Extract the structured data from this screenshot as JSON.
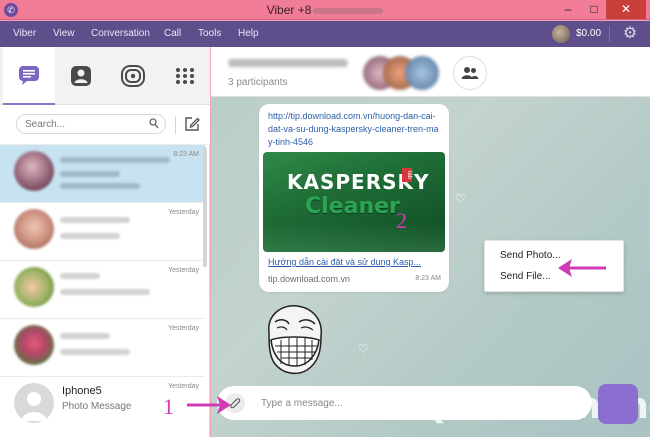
{
  "window": {
    "title": "Viber +8",
    "controls": [
      "minimize",
      "maximize",
      "close"
    ]
  },
  "menu": {
    "items": [
      "Viber",
      "View",
      "Conversation",
      "Call",
      "Tools",
      "Help"
    ],
    "balance": "$0.00"
  },
  "sidebar": {
    "tabs": [
      {
        "name": "chats-icon",
        "active": true
      },
      {
        "name": "contacts-icon",
        "active": false
      },
      {
        "name": "public-chats-icon",
        "active": false
      },
      {
        "name": "dialpad-icon",
        "active": false
      }
    ],
    "search_placeholder": "Search...",
    "conversations": [
      {
        "time": "8:23 AM",
        "selected": true
      },
      {
        "time": "Yesterday",
        "selected": false
      },
      {
        "time": "Yesterday",
        "selected": false
      },
      {
        "time": "Yesterday",
        "selected": false
      },
      {
        "name": "Iphone5",
        "subtitle": "Photo Message",
        "time": "Yesterday",
        "selected": false
      }
    ]
  },
  "chat": {
    "participants": "3 participants",
    "link_message": {
      "url": "http://tip.download.com.vn/huong-dan-cai-dat-va-su-dung-kaspersky-cleaner-tren-may-tinh-4546",
      "preview_brand": "KASPERSKY",
      "preview_lab": "lab",
      "preview_product": "Cleaner",
      "title": "Hướng dẫn cài đặt và sử dụng Kasp...",
      "domain": "tip.download.com.vn",
      "time": "8:23 AM"
    },
    "attach_menu": {
      "items": [
        "Send Photo...",
        "Send File..."
      ]
    },
    "input_placeholder": "Type a message...",
    "watermark": "Quantrimang"
  },
  "annotations": {
    "label_1": "1",
    "label_2": "2",
    "color": "#d03ab6"
  }
}
